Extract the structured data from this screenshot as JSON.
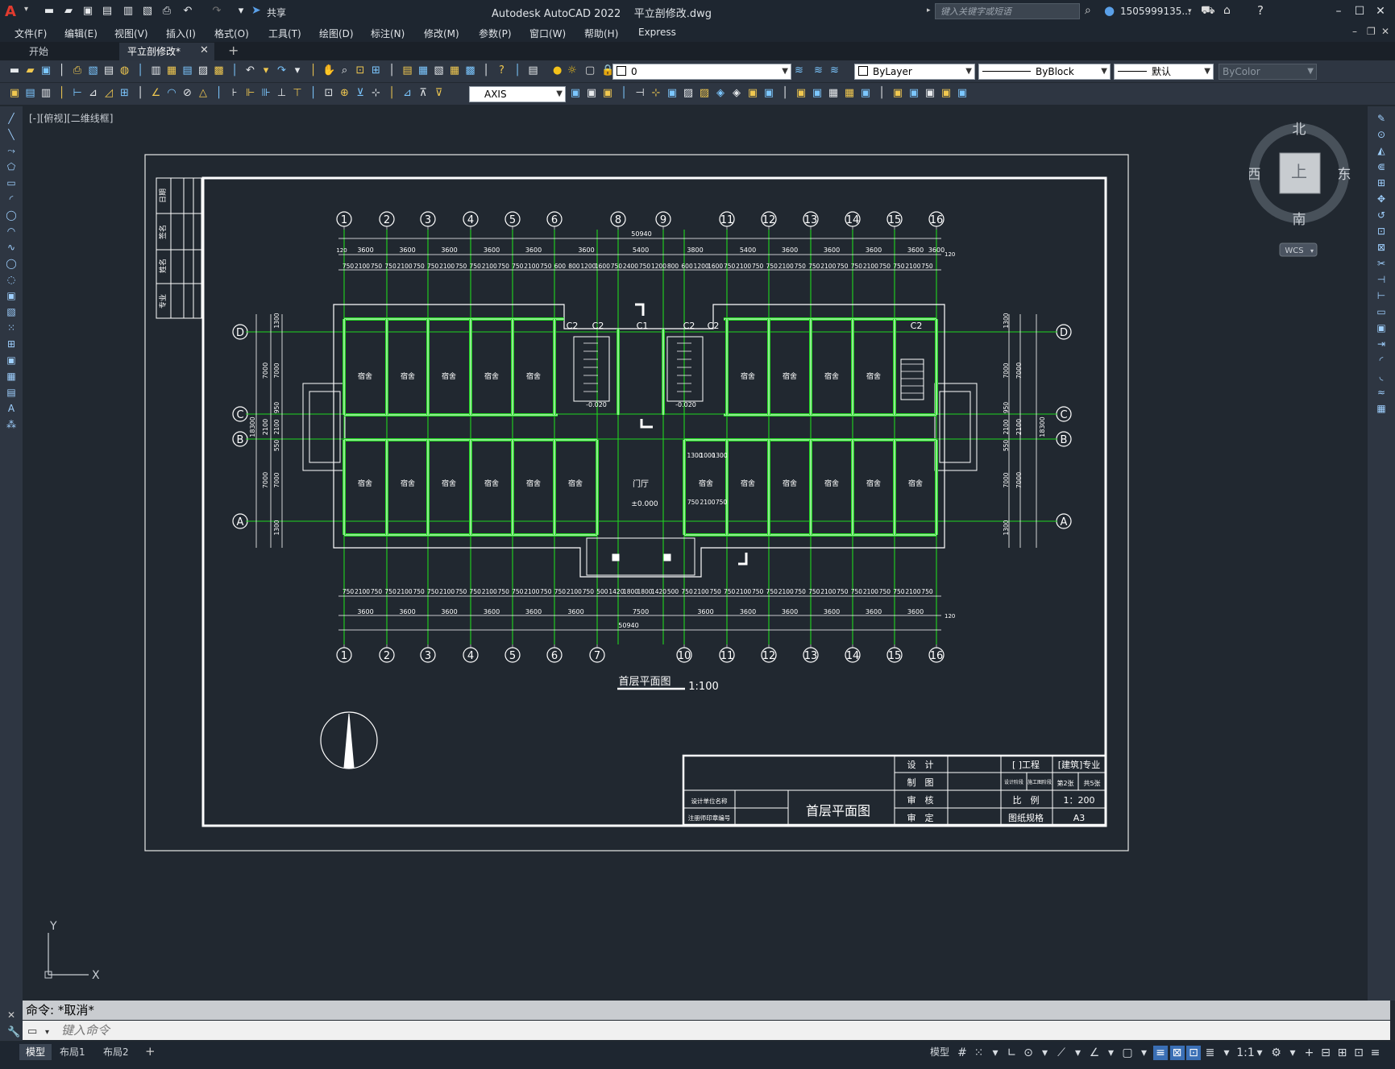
{
  "app": {
    "title": "Autodesk AutoCAD 2022",
    "document": "平立剖修改.dwg",
    "search_placeholder": "键入关键字或短语",
    "user": "1505999135...",
    "share_label": "共享"
  },
  "menu": [
    "文件(F)",
    "编辑(E)",
    "视图(V)",
    "插入(I)",
    "格式(O)",
    "工具(T)",
    "绘图(D)",
    "标注(N)",
    "修改(M)",
    "参数(P)",
    "窗口(W)",
    "帮助(H)",
    "Express"
  ],
  "tabs": [
    {
      "label": "开始",
      "active": false
    },
    {
      "label": "平立剖修改*",
      "active": true
    }
  ],
  "toolbar": {
    "layer_value": "0",
    "color_value": "ByLayer",
    "linetype_value": "ByBlock",
    "lineweight_value": "默认",
    "plotstyle_value": "ByColor",
    "dimstyle_value": "AXIS"
  },
  "viewport_label": "[-][俯视][二维线框]",
  "viewcube": {
    "north": "北",
    "south": "南",
    "east": "东",
    "west": "西",
    "face": "上",
    "wcs": "WCS"
  },
  "command": {
    "history": "命令: *取消*",
    "placeholder": "键入命令"
  },
  "layout_tabs": [
    {
      "label": "模型",
      "active": true
    },
    {
      "label": "布局1",
      "active": false
    },
    {
      "label": "布局2",
      "active": false
    }
  ],
  "status": {
    "model": "模型",
    "scale": "1:1"
  },
  "drawing": {
    "axes_top": [
      "1",
      "2",
      "3",
      "4",
      "5",
      "6",
      "8",
      "9",
      "11",
      "12",
      "13",
      "14",
      "15",
      "16"
    ],
    "axes_bottom": [
      "1",
      "2",
      "3",
      "4",
      "5",
      "6",
      "7",
      "10",
      "11",
      "12",
      "13",
      "14",
      "15",
      "16"
    ],
    "axes_rows": [
      "D",
      "C",
      "B",
      "A"
    ],
    "dims_top_outer": [
      "3600",
      "3600",
      "3600",
      "3600",
      "3600",
      "3600",
      "5400",
      "3800",
      "5400",
      "3600",
      "3600",
      "3600",
      "3600",
      "3600"
    ],
    "dims_top_total": "50940",
    "dims_top_inner": [
      "750",
      "2100",
      "750",
      "750",
      "2100",
      "750",
      "750",
      "2100",
      "750",
      "750",
      "2100",
      "750",
      "750",
      "2100",
      "750",
      "600",
      "800",
      "1200",
      "1600",
      "750",
      "2400",
      "750",
      "1200",
      "800",
      "600",
      "1200",
      "1600",
      "750",
      "2100",
      "750",
      "750",
      "2100",
      "750",
      "750",
      "2100",
      "750",
      "750",
      "2100",
      "750",
      "750",
      "2100",
      "750"
    ],
    "dims_bottom_inner": [
      "750",
      "2100",
      "750",
      "750",
      "2100",
      "750",
      "750",
      "2100",
      "750",
      "750",
      "2100",
      "750",
      "750",
      "2100",
      "750",
      "750",
      "2100",
      "750",
      "500",
      "1420",
      "1800",
      "1800",
      "1420",
      "500",
      "750",
      "2100",
      "750",
      "750",
      "2100",
      "750",
      "750",
      "2100",
      "750",
      "750",
      "2100",
      "750",
      "750",
      "2100",
      "750",
      "750",
      "2100",
      "750"
    ],
    "dims_bottom_outer": [
      "3600",
      "3600",
      "3600",
      "3600",
      "3600",
      "3600",
      "7500",
      "3600",
      "3600",
      "3600",
      "3600",
      "3600",
      "3600"
    ],
    "dims_bottom_total": "50940",
    "dim_120": "120",
    "dims_left": [
      "1300",
      "7000",
      "950",
      "2100",
      "550",
      "7000",
      "1300"
    ],
    "dims_left_outer": [
      "7000",
      "2100",
      "7000"
    ],
    "dims_left_total": "18300",
    "dims_right": [
      "1300",
      "7000",
      "950",
      "2100",
      "550",
      "7000",
      "1300"
    ],
    "dims_right_outer": [
      "7000",
      "2100",
      "7000"
    ],
    "dims_right_total": "18300",
    "room_label": "宿舍",
    "lobby_label": "门厅",
    "level_lobby": "±0.000",
    "level_stair_l": "-0.020",
    "level_stair_r": "-0.020",
    "window_tags": [
      "C2",
      "C2",
      "C1",
      "C2",
      "C2",
      "C2"
    ],
    "lobby_dims": [
      "1300",
      "1000",
      "1300",
      "750",
      "2100",
      "750"
    ],
    "plan_title": "首层平面图",
    "plan_scale": "1:100",
    "sidebar": [
      "日期",
      "签名",
      "姓名",
      "专业"
    ],
    "titleblock": {
      "design": "设　计",
      "draft": "制　图",
      "check": "审　核",
      "approve": "审　定",
      "project": "[ ]工程",
      "discipline": "[建筑]专业",
      "design_stage": "设计阶段",
      "construction": "施工图阶段",
      "sheet_count": "第2张",
      "total": "共5张",
      "scale_label": "比　例",
      "scale_value": "1：200",
      "sheet_size_label": "图纸规格",
      "sheet_size": "A3",
      "company": "设计单位名称",
      "reg_no": "注册师印章编号",
      "drawing_name": "首层平面图"
    }
  },
  "colors": {
    "accent": "#3a6fb5",
    "axis_green": "#1fd61f",
    "background": "#212830"
  }
}
